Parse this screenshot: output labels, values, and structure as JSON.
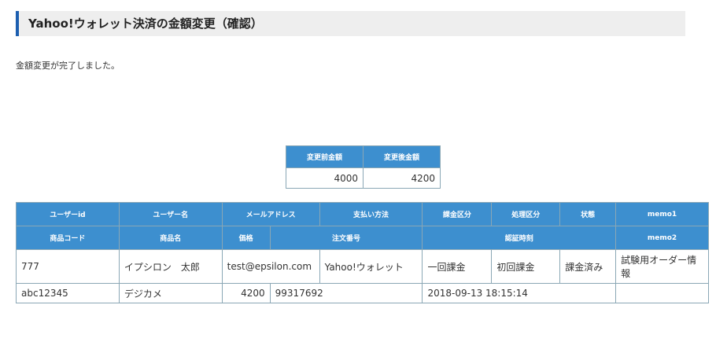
{
  "header": {
    "title": "Yahoo!ウォレット決済の金額変更（確認）"
  },
  "message": "金額変更が完了しました。",
  "amount_table": {
    "headers": [
      "変更前金額",
      "変更後金額"
    ],
    "values": [
      "4000",
      "4200"
    ]
  },
  "detail_table": {
    "header_row1": [
      "ユーザーid",
      "ユーザー名",
      "メールアドレス",
      "支払い方法",
      "課金区分",
      "処理区分",
      "状態",
      "memo1"
    ],
    "header_row2": [
      "商品コード",
      "商品名",
      "価格",
      "注文番号",
      "認証時刻",
      "memo2"
    ],
    "row1": [
      "777",
      "イプシロン　太郎",
      "test@epsilon.com",
      "Yahoo!ウォレット",
      "一回課金",
      "初回課金",
      "課金済み",
      "試験用オーダー情報"
    ],
    "row2": [
      "abc12345",
      "デジカメ",
      "4200",
      "99317692",
      "2018-09-13 18:15:14",
      ""
    ]
  }
}
